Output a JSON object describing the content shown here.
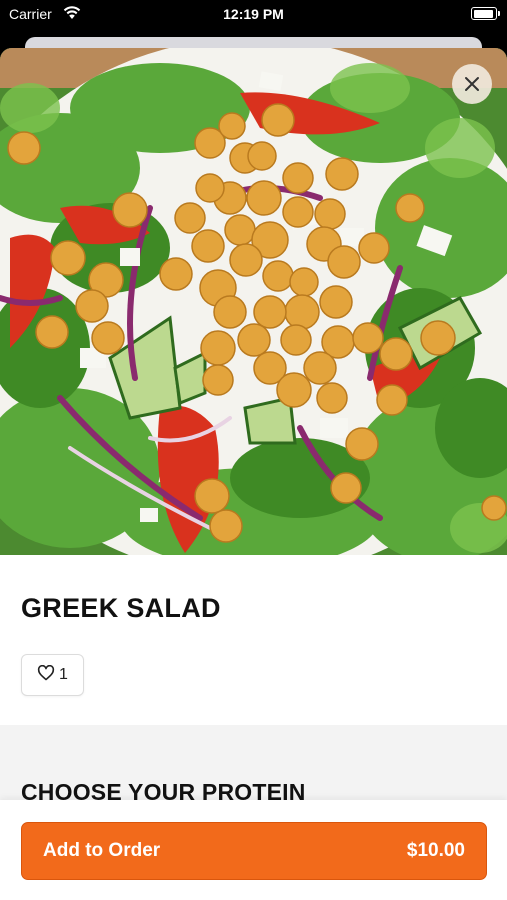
{
  "status_bar": {
    "carrier": "Carrier",
    "time": "12:19 PM"
  },
  "hero": {
    "image": "greek-salad-photo"
  },
  "item": {
    "title": "GREEK SALAD",
    "like_count": "1"
  },
  "options": {
    "section_title": "CHOOSE YOUR PROTEIN"
  },
  "order": {
    "button_label": "Add to Order",
    "price": "$10.00"
  },
  "colors": {
    "accent": "#f26a1b",
    "section_bg": "#f3f3f3"
  },
  "icons": {
    "close": "close-icon",
    "heart": "heart-icon",
    "wifi": "wifi-icon",
    "battery": "battery-icon"
  }
}
